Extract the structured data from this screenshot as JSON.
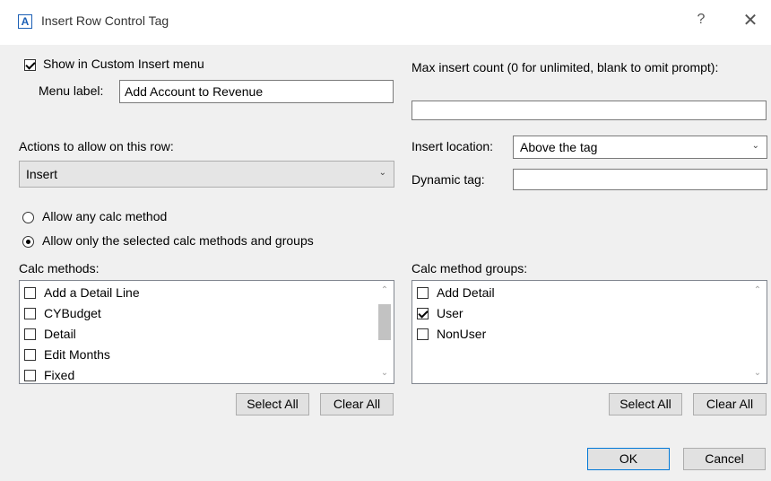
{
  "window": {
    "icon_letter": "A",
    "title": "Insert Row Control Tag",
    "help_glyph": "?",
    "close_glyph": "✕"
  },
  "custom_insert": {
    "show_label": "Show in Custom Insert menu",
    "show_checked": true,
    "menu_label_caption": "Menu label:",
    "menu_label_value": "Add Account to Revenue"
  },
  "max_insert": {
    "label": "Max insert count (0 for unlimited, blank to omit prompt):",
    "value": ""
  },
  "actions": {
    "label": "Actions to allow on this row:",
    "value": "Insert"
  },
  "insert_location": {
    "label": "Insert location:",
    "value": "Above the tag"
  },
  "dynamic_tag": {
    "label": "Dynamic tag:",
    "value": ""
  },
  "calc_mode": {
    "option_any": "Allow any calc method",
    "option_selected": "Allow only the selected calc methods and groups",
    "selected": "option_selected"
  },
  "calc_methods": {
    "label": "Calc methods:",
    "items": [
      {
        "label": "Add a Detail Line",
        "checked": false
      },
      {
        "label": "CYBudget",
        "checked": false
      },
      {
        "label": "Detail",
        "checked": false
      },
      {
        "label": "Edit Months",
        "checked": false
      },
      {
        "label": "Fixed",
        "checked": false
      }
    ],
    "select_all": "Select All",
    "clear_all": "Clear All"
  },
  "calc_method_groups": {
    "label": "Calc method groups:",
    "items": [
      {
        "label": "Add Detail",
        "checked": false
      },
      {
        "label": "User",
        "checked": true
      },
      {
        "label": "NonUser",
        "checked": false
      }
    ],
    "select_all": "Select All",
    "clear_all": "Clear All"
  },
  "footer": {
    "ok": "OK",
    "cancel": "Cancel"
  },
  "icons": {
    "dropdown": "chevron-down-icon",
    "scroll_up": "chevron-up-icon",
    "scroll_down": "chevron-down-icon"
  }
}
